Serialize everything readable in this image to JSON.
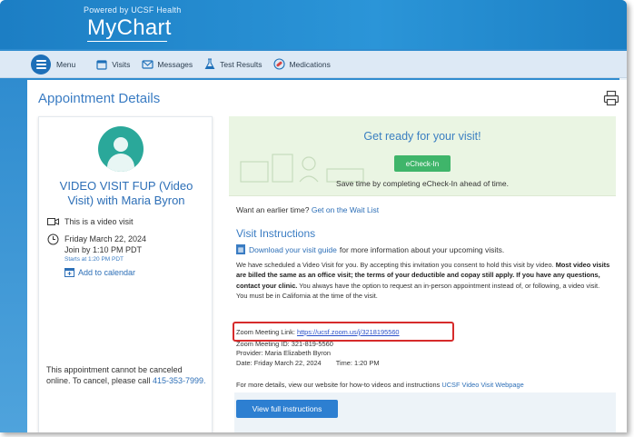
{
  "header": {
    "powered_by": "Powered by UCSF Health",
    "app_name": "MyChart"
  },
  "nav": {
    "menu_label": "Menu",
    "items": [
      {
        "label": "Visits",
        "icon": "calendar-icon"
      },
      {
        "label": "Messages",
        "icon": "envelope-icon"
      },
      {
        "label": "Test Results",
        "icon": "flask-icon"
      },
      {
        "label": "Medications",
        "icon": "pill-icon"
      }
    ]
  },
  "page": {
    "title": "Appointment Details"
  },
  "appointment": {
    "title": "VIDEO VISIT FUP (Video Visit) with Maria Byron",
    "video_label": "This is a video visit",
    "date": "Friday March 22, 2024",
    "join_by": "Join by 1:10 PM PDT",
    "starts_at": "Starts at 1:20 PM PDT",
    "add_calendar": "Add to calendar",
    "cancel_note_1": "This appointment cannot be canceled online. To cancel, please call",
    "cancel_phone": "415-353-7999."
  },
  "banner": {
    "title": "Get ready for your visit!",
    "button": "eCheck-In",
    "subtitle": "Save time by completing eCheck-In ahead of time."
  },
  "details": {
    "wait_prefix": "Want an earlier time?",
    "wait_link": "Get on the Wait List",
    "section_title": "Visit Instructions",
    "guide_link": "Download your visit guide",
    "guide_suffix": "for more information about your upcoming visits.",
    "para_1": "We have scheduled a Video Visit for you. By accepting this invitation you consent to hold this visit by video.",
    "para_bold": "Most video visits are billed the same as an office visit; the terms of your deductible and copay still apply. If you have any questions, contact your clinic.",
    "para_2": "You always have the option to request an in-person appointment instead of, or following, a video visit. You must be in California at the time of the visit.",
    "zoom_label": "Zoom Meeting Link:",
    "zoom_url": "https://ucsf.zoom.us/j/3218195560",
    "zoom_id": "Zoom Meeting ID: 321-819-5560",
    "provider": "Provider: Maria Elizabeth Byron",
    "date_line": "Date: Friday March 22, 2024",
    "time_line": "Time: 1:20 PM",
    "more_prefix": "For more details, view our website for how-to videos and instructions",
    "more_link": "UCSF Video Visit Webpage",
    "full_button": "View full instructions"
  }
}
